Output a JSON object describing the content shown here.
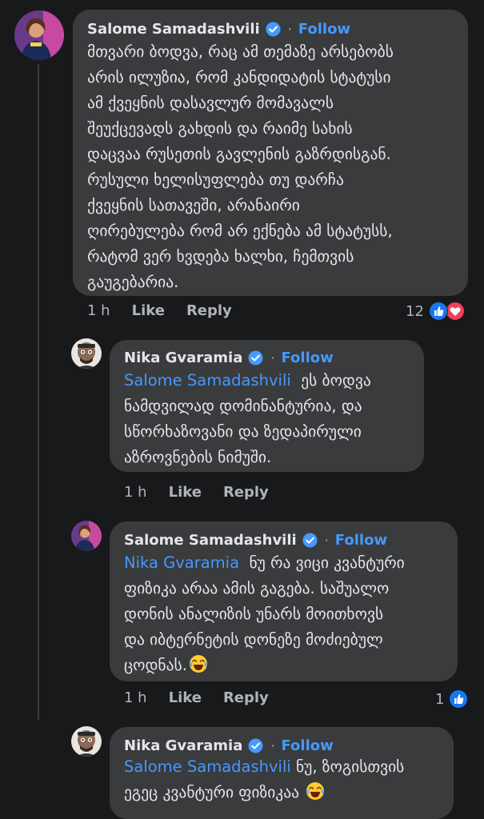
{
  "comments": [
    {
      "author": "Salome Samadashvili",
      "follow_label": "Follow",
      "mention": "",
      "text": "მთვარი ბოდვა, რაც ამ თემაზე არსებობს\nარის ილუზია, რომ კანდიდატის სტატუსი\nამ ქვეყნის დასავლურ მომავალს\nშეუქცევადს გახდის და რაიმე სახის\nდაცვაა რუსეთის გავლენის გაზრდისგან.\nრუსული ხელისუფლება თუ დარჩა\nქვეყნის სათავეში, არანაირი\nღირებულება რომ არ ექნება ამ სტატუსს,\nრატომ ვერ ხვდება ხალხი, ჩემთვის\nგაუგებარია.",
      "time": "1 h",
      "like_label": "Like",
      "reply_label": "Reply",
      "reaction_count": "12"
    },
    {
      "author": "Nika Gvaramia",
      "follow_label": "Follow",
      "mention": "Salome Samadashvili",
      "text": "ეს ბოდვა\nნამდვილად დომინანტურია, და\nსწორხაზოვანი და ზედაპირული\nაზროვნების ნიმუში.",
      "time": "1 h",
      "like_label": "Like",
      "reply_label": "Reply",
      "reaction_count": ""
    },
    {
      "author": "Salome Samadashvili",
      "follow_label": "Follow",
      "mention": "Nika Gvaramia",
      "text": "ნუ რა ვიცი კვანტური\nფიზიკა არაა ამის გაგება. საშუალო\nდონის ანალიზის უნარს მოითხოვს\nდა იბტერნეტის დონეზე მოძიებულ\nცოდნას.",
      "time": "1 h",
      "like_label": "Like",
      "reply_label": "Reply",
      "reaction_count": "1"
    },
    {
      "author": "Nika Gvaramia",
      "follow_label": "Follow",
      "mention": "Salome Samadashvili",
      "text": "ნუ, ზოგისთვის\nეგეც კვანტური ფიზიკაა",
      "time": "",
      "like_label": "",
      "reply_label": "",
      "reaction_count": ""
    }
  ],
  "colors": {
    "background": "#18191a",
    "bubble": "#3a3b3c",
    "link": "#4599ff",
    "like_reaction": "#1877f2",
    "love_reaction": "#f33e58"
  },
  "icons": {
    "verified": "verified-badge-icon",
    "like": "like-reaction-icon",
    "love": "love-reaction-icon",
    "laugh": "laughing-emoji-icon"
  }
}
